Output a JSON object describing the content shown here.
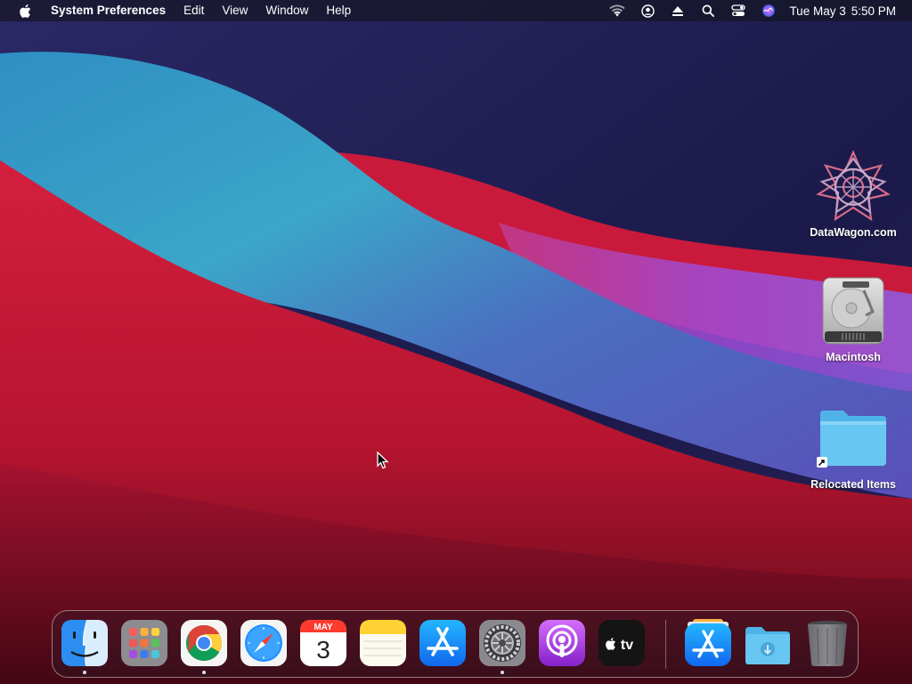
{
  "menubar": {
    "apple_icon": "apple-logo-icon",
    "app_name": "System Preferences",
    "menus": [
      "Edit",
      "View",
      "Window",
      "Help"
    ],
    "status_icons": [
      "wifi-icon",
      "user-icon",
      "eject-icon",
      "spotlight-search-icon",
      "control-center-icon",
      "siri-icon"
    ],
    "date": "Tue May 3",
    "time": "5:50 PM"
  },
  "desktop": {
    "icons": [
      {
        "label": "DataWagon.com",
        "icon": "datawagon-logo-icon"
      },
      {
        "label": "Macintosh",
        "icon": "hard-drive-icon"
      },
      {
        "label": "Relocated Items",
        "icon": "folder-alias-icon"
      }
    ]
  },
  "dock": {
    "apps": [
      {
        "name": "Finder",
        "icon": "finder-icon",
        "running": true
      },
      {
        "name": "Launchpad",
        "icon": "launchpad-icon",
        "running": false
      },
      {
        "name": "Google Chrome",
        "icon": "chrome-icon",
        "running": true
      },
      {
        "name": "Safari",
        "icon": "safari-icon",
        "running": false
      },
      {
        "name": "Calendar",
        "icon": "calendar-icon",
        "running": false,
        "month": "MAY",
        "day": "3"
      },
      {
        "name": "Notes",
        "icon": "notes-icon",
        "running": false
      },
      {
        "name": "App Store",
        "icon": "app-store-icon",
        "running": false
      },
      {
        "name": "System Preferences",
        "icon": "system-preferences-icon",
        "running": true
      },
      {
        "name": "Podcasts",
        "icon": "podcasts-icon",
        "running": false
      },
      {
        "name": "Apple TV",
        "icon": "apple-tv-icon",
        "running": false,
        "tv_text": "tv"
      }
    ],
    "stacks": [
      {
        "name": "Applications",
        "icon": "applications-stack-icon"
      },
      {
        "name": "Downloads",
        "icon": "downloads-folder-icon"
      },
      {
        "name": "Trash",
        "icon": "trash-icon"
      }
    ]
  },
  "colors": {
    "menubar_bg": "#14141c",
    "wallpaper_navy": "#1d1b4f",
    "wallpaper_red": "#c8183a",
    "wallpaper_teal": "#3aa3c9",
    "wallpaper_purple": "#8a4fd9",
    "folder_blue": "#5ec2ef"
  }
}
